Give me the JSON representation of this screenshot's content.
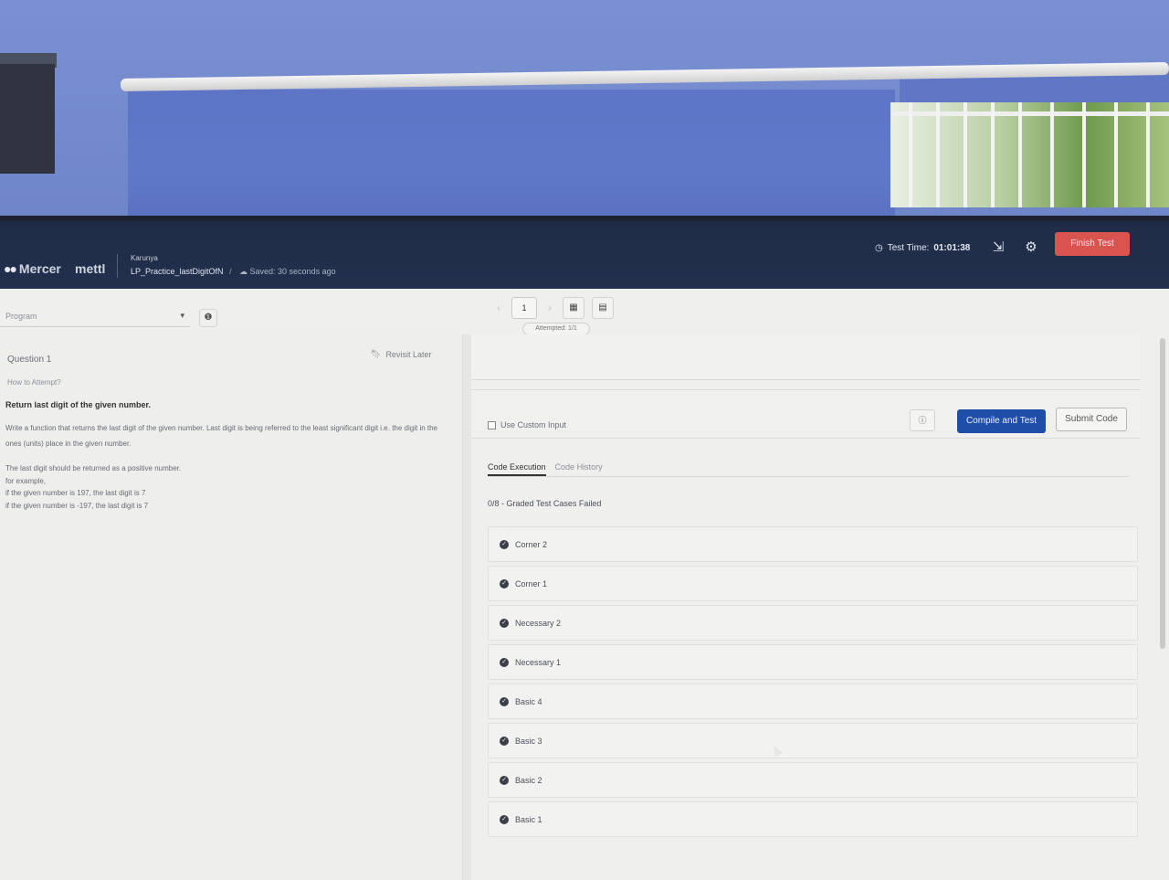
{
  "header": {
    "logo_primary": "Mercer",
    "logo_secondary": "mettl",
    "user_name": "Karunya",
    "test_name": "LP_Practice_lastDigitOfN",
    "breadcrumb_sep": "/",
    "saved_status": "Saved: 30 seconds ago",
    "timer_label": "Test Time:",
    "timer_value": "01:01:38",
    "finish_label": "Finish Test"
  },
  "toolbar": {
    "language_placeholder": "Program",
    "page_current": "1",
    "attempted": "Attempted: 1/1"
  },
  "question": {
    "title": "Question 1",
    "revisit_label": "Revisit Later",
    "how_to": "How to Attempt?",
    "heading": "Return last digit of the given number.",
    "paragraph1": "Write a function that returns the last digit of the given number. Last digit is being referred to the least significant digit i.e. the digit in the ones (units) place in the given number.",
    "paragraph2": "The last digit should be returned as a positive number.",
    "line_example": "for example,",
    "line_ex1": "if the given number is 197, the last digit is 7",
    "line_ex2": "if the given number is -197, the last digit is 7"
  },
  "runner": {
    "custom_input_label": "Use Custom Input",
    "compile_label": "Compile and Test",
    "submit_label": "Submit Code",
    "tabs": [
      {
        "label": "Code Execution"
      },
      {
        "label": "Code History"
      }
    ],
    "summary": "0/8 - Graded Test Cases Failed",
    "cases": [
      {
        "label": "Corner 2"
      },
      {
        "label": "Corner 1"
      },
      {
        "label": "Necessary 2"
      },
      {
        "label": "Necessary 1"
      },
      {
        "label": "Basic 4"
      },
      {
        "label": "Basic 3"
      },
      {
        "label": "Basic 2"
      },
      {
        "label": "Basic 1"
      }
    ]
  },
  "colors": {
    "header_bg": "#1f2c47",
    "finish_btn": "#d9534f",
    "compile_btn": "#1f4ea8"
  }
}
